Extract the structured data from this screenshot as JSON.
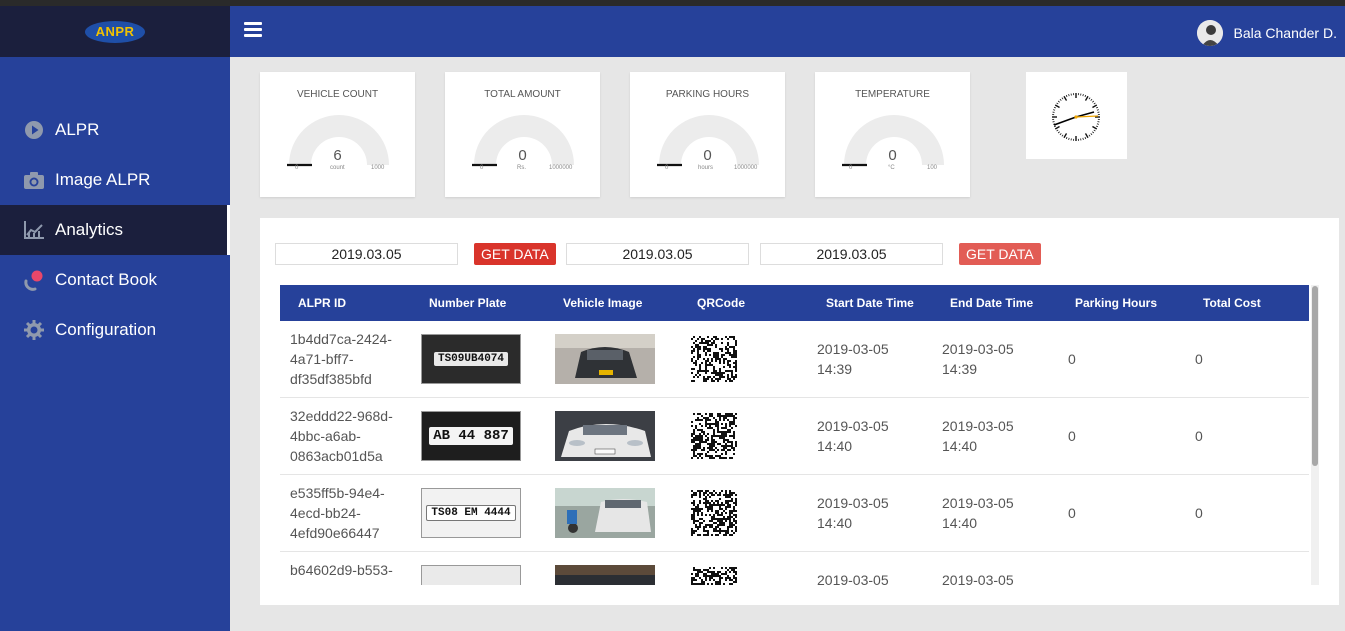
{
  "brand": {
    "logo_text": "ANPR",
    "logo_accent": "#f2c200"
  },
  "sidebar": {
    "items": [
      {
        "label": "ALPR",
        "icon": "play-circle-icon",
        "active": false
      },
      {
        "label": "Image ALPR",
        "icon": "camera-icon",
        "active": false
      },
      {
        "label": "Analytics",
        "icon": "chart-icon",
        "active": true
      },
      {
        "label": "Contact Book",
        "icon": "contact-icon",
        "active": false
      },
      {
        "label": "Configuration",
        "icon": "gear-icon",
        "active": false
      }
    ]
  },
  "header": {
    "menu_icon": "hamburger-icon",
    "user_name": "Bala Chander D."
  },
  "gauges": [
    {
      "title": "VEHICLE COUNT",
      "value": "6",
      "min": "0",
      "max": "1000",
      "unit": "count",
      "level": 0.006
    },
    {
      "title": "TOTAL AMOUNT",
      "value": "0",
      "min": "0",
      "max": "1000000",
      "unit": "Rs.",
      "level": 0
    },
    {
      "title": "PARKING HOURS",
      "value": "0",
      "min": "0",
      "max": "1000000",
      "unit": "hours",
      "level": 0
    },
    {
      "title": "TEMPERATURE",
      "value": "0",
      "min": "0",
      "max": "100",
      "unit": "°C",
      "level": 0
    }
  ],
  "filters": {
    "date_1": "2019.03.05",
    "get_data_1": "GET DATA",
    "date_2": "2019.03.05",
    "date_3": "2019.03.05",
    "get_data_2": "GET DATA"
  },
  "table": {
    "columns": [
      "ALPR ID",
      "Number Plate",
      "Vehicle Image",
      "QRCode",
      "Start Date Time",
      "End Date Time",
      "Parking Hours",
      "Total Cost"
    ],
    "rows": [
      {
        "id_1": "1b4dd7ca-2424-",
        "id_2": "4a71-bff7-",
        "id_3": "df35df385bfd",
        "plate": "TS09UB4074",
        "start_date": "2019-03-05",
        "start_time": "14:39",
        "end_date": "2019-03-05",
        "end_time": "14:39",
        "hours": "0",
        "cost": "0"
      },
      {
        "id_1": "32eddd22-968d-",
        "id_2": "4bbc-a6ab-",
        "id_3": "0863acb01d5a",
        "plate": "AB 44 887",
        "start_date": "2019-03-05",
        "start_time": "14:40",
        "end_date": "2019-03-05",
        "end_time": "14:40",
        "hours": "0",
        "cost": "0"
      },
      {
        "id_1": "e535ff5b-94e4-",
        "id_2": "4ecd-bb24-",
        "id_3": "4efd90e66447",
        "plate": "TS08 EM 4444",
        "start_date": "2019-03-05",
        "start_time": "14:40",
        "end_date": "2019-03-05",
        "end_time": "14:40",
        "hours": "0",
        "cost": "0"
      },
      {
        "id_1": "b64602d9-b553-",
        "id_2": "",
        "id_3": "",
        "plate": "",
        "start_date": "2019-03-05",
        "start_time": "",
        "end_date": "2019-03-05",
        "end_time": "",
        "hours": "",
        "cost": ""
      }
    ]
  },
  "colors": {
    "primary": "#26419a",
    "sidebar_dark": "#1b1f3d",
    "button_red": "#d9342b"
  }
}
